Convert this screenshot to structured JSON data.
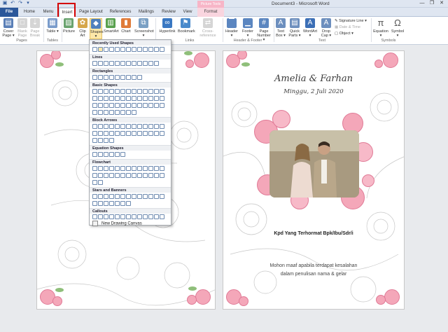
{
  "window": {
    "title": "Document3 - Microsoft Word",
    "contextual_group": "Picture Tools",
    "controls": [
      "minimize",
      "restore",
      "close"
    ]
  },
  "quick_access": [
    "save-icon",
    "undo-icon",
    "redo-icon",
    "customize-icon"
  ],
  "tabs": [
    {
      "label": "File"
    },
    {
      "label": "Home"
    },
    {
      "label": "Menu"
    },
    {
      "label": "Insert"
    },
    {
      "label": "Page Layout"
    },
    {
      "label": "References"
    },
    {
      "label": "Mailings"
    },
    {
      "label": "Review"
    },
    {
      "label": "View"
    },
    {
      "label": "Format"
    }
  ],
  "active_tab": "Insert",
  "ribbon": {
    "pages": {
      "cover": "Cover Page",
      "cover_dd": "▾",
      "blank": "Blank Page",
      "break": "Page Break",
      "label": "Pages"
    },
    "tables": {
      "table": "Table",
      "table_dd": "▾",
      "label": "Tables"
    },
    "illustrations": {
      "picture": "Picture",
      "clip": "Clip Art",
      "shapes": "Shapes",
      "shapes_dd": "▾",
      "smartart": "SmartArt",
      "chart": "Chart",
      "screenshot": "Screenshot",
      "screenshot_dd": "▾"
    },
    "links": {
      "hyperlink": "Hyperlink",
      "bookmark": "Bookmark",
      "crossref": "Cross-reference",
      "label": "Links"
    },
    "header_footer": {
      "header": "Header",
      "footer": "Footer",
      "page_number": "Page Number",
      "dd": "▾",
      "label": "Header & Footer"
    },
    "text": {
      "textbox": "Text Box",
      "quickparts": "Quick Parts",
      "wordart": "WordArt",
      "dropcap": "Drop Cap",
      "dd": "▾",
      "sigline": "Signature Line",
      "datetime": "Date & Time",
      "object": "Object",
      "label": "Text"
    },
    "symbols": {
      "equation": "Equation",
      "symbol": "Symbol",
      "dd": "▾",
      "label": "Symbols"
    }
  },
  "shapes_menu": {
    "sections": [
      "Recently Used Shapes",
      "Lines",
      "Rectangles",
      "Basic Shapes",
      "Block Arrows",
      "Equation Shapes",
      "Flowchart",
      "Stars and Banners",
      "Callouts"
    ],
    "new_canvas": "New Drawing Canvas"
  },
  "document": {
    "names": "Amelia & Farhan",
    "date": "Minggu, 2 Juli 2020",
    "guest_line": "Kpd Yang Terhormat Bpk/Ibu/Sdr/i",
    "apology": [
      "Mohon maaf apabila terdapat kesalahan",
      "dalam penulisan nama & gelar"
    ]
  },
  "colors": {
    "file_tab": "#2b579a",
    "context_tab": "#f7b5c7",
    "highlight_box": "#d40000",
    "rose": "#f4a7b9"
  }
}
